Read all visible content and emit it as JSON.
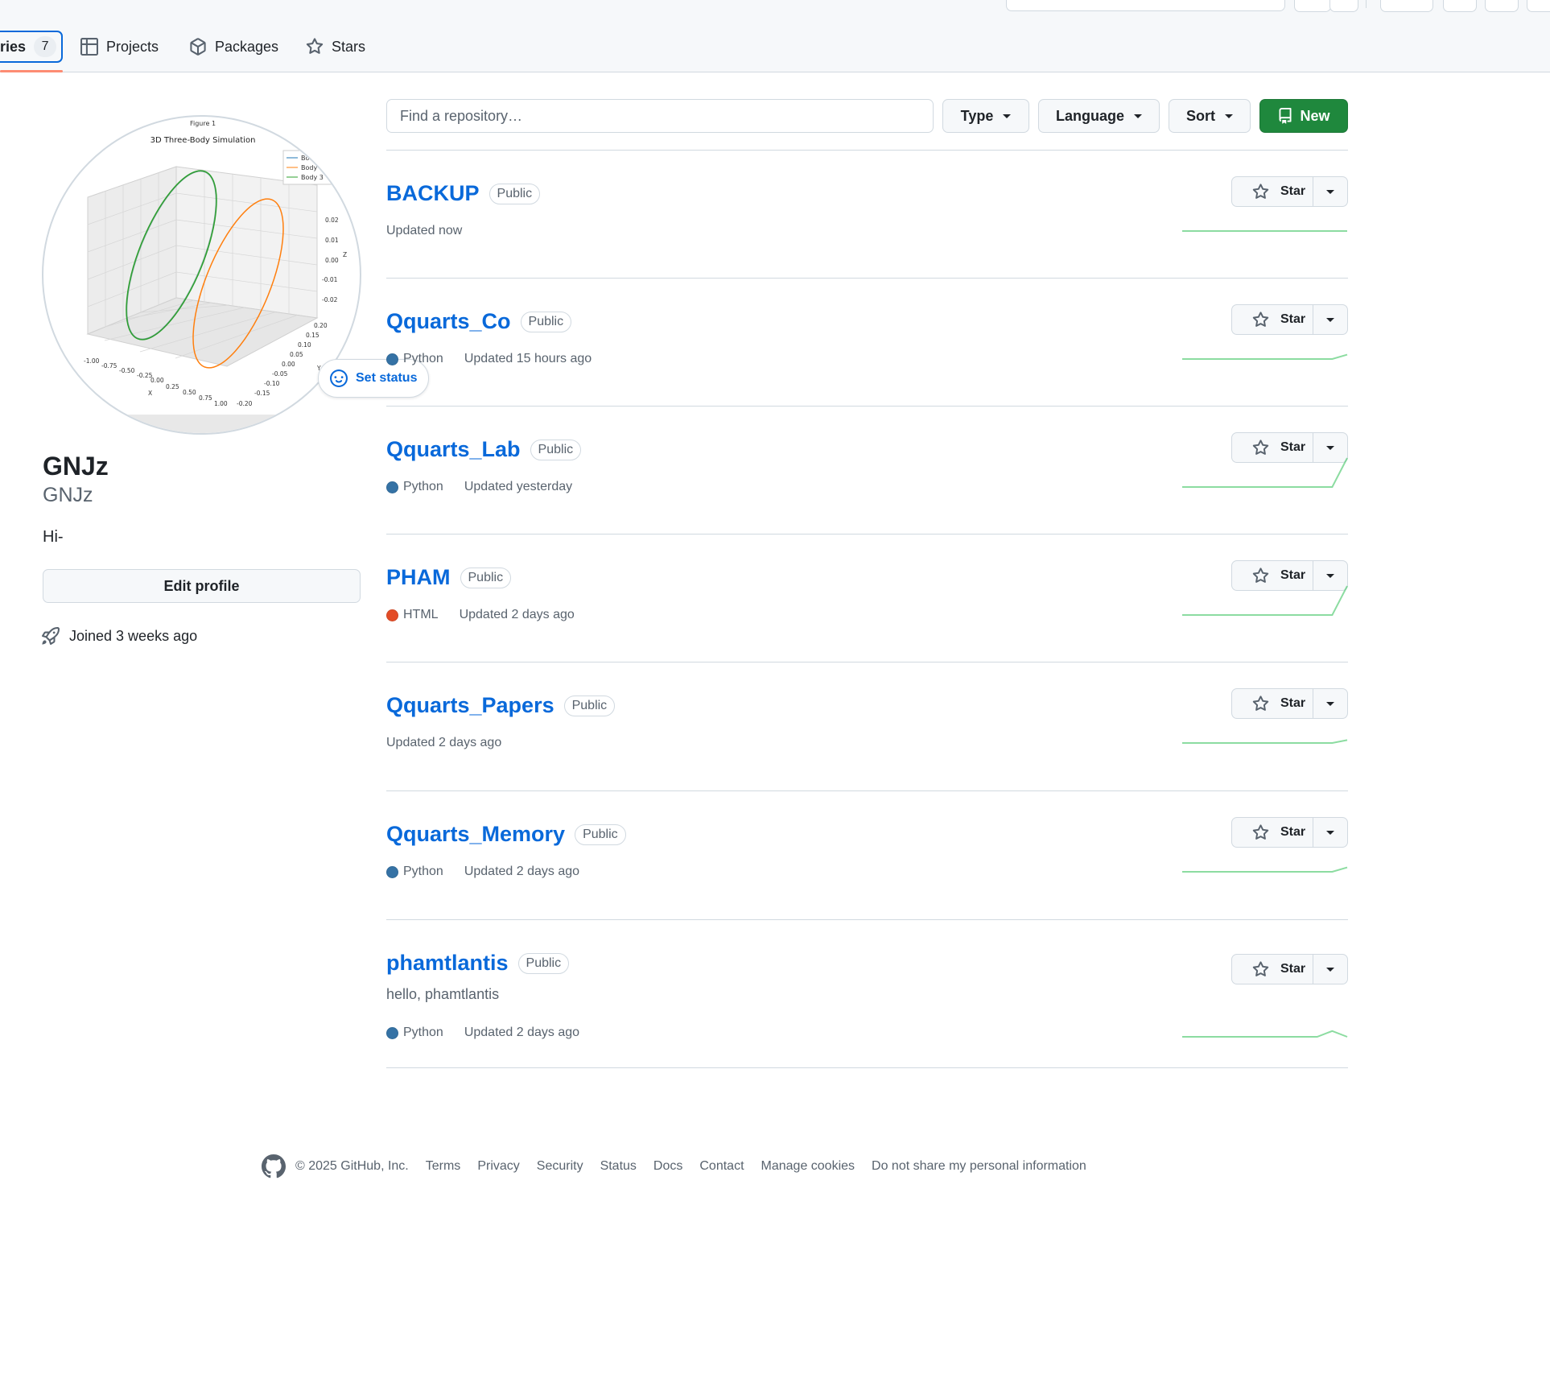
{
  "tabs": [
    {
      "label": "ries",
      "count": "7",
      "active": true,
      "icon": "repo-icon"
    },
    {
      "label": "Projects",
      "icon": "table-icon"
    },
    {
      "label": "Packages",
      "icon": "package-icon"
    },
    {
      "label": "Stars",
      "icon": "star-icon"
    }
  ],
  "profile": {
    "name": "GNJz",
    "login": "GNJz",
    "bio": "Hi-",
    "edit_label": "Edit profile",
    "joined": "Joined 3 weeks ago",
    "set_status_label": "Set status",
    "avatar": {
      "figure_label": "Figure 1",
      "plot_title": "3D Three-Body Simulation",
      "legend": [
        "Body",
        "Body",
        "Body 3"
      ],
      "x_label": "X",
      "y_label": "Y",
      "z_label": "Z",
      "x_ticks": [
        "-1.00",
        "-0.75",
        "-0.50",
        "-0.25",
        "0.00",
        "0.25",
        "0.50",
        "0.75",
        "1.00"
      ],
      "y_ticks": [
        "0.20",
        "0.15",
        "0.10",
        "0.05",
        "0.00",
        "-0.05",
        "-0.10",
        "-0.15",
        "-0.20"
      ],
      "z_ticks": [
        "0.02",
        "0.01",
        "0.00",
        "-0.01",
        "-0.02"
      ],
      "colors": {
        "body1": "#1f77b4",
        "body2": "#ff7f0e",
        "body3": "#2ca02c"
      }
    }
  },
  "filters": {
    "search_placeholder": "Find a repository…",
    "type_label": "Type",
    "language_label": "Language",
    "sort_label": "Sort",
    "new_label": "New"
  },
  "repos": [
    {
      "name": "BACKUP",
      "visibility": "Public",
      "description": "",
      "language": "",
      "language_color": "",
      "updated": "Updated now",
      "star_label": "Star",
      "activity": [
        0,
        0,
        0,
        0,
        0,
        0,
        0,
        0,
        0,
        0,
        0,
        0
      ]
    },
    {
      "name": "Qquarts_Co",
      "visibility": "Public",
      "description": "",
      "language": "Python",
      "language_color": "#3572A5",
      "updated": "Updated 15 hours ago",
      "star_label": "Star",
      "activity": [
        0,
        0,
        0,
        0,
        0,
        0,
        0,
        0,
        0,
        0,
        0,
        0.15
      ]
    },
    {
      "name": "Qquarts_Lab",
      "visibility": "Public",
      "description": "",
      "language": "Python",
      "language_color": "#3572A5",
      "updated": "Updated yesterday",
      "star_label": "Star",
      "activity": [
        0,
        0,
        0,
        0,
        0,
        0,
        0,
        0,
        0,
        0,
        0,
        1
      ]
    },
    {
      "name": "PHAM",
      "visibility": "Public",
      "description": "",
      "language": "HTML",
      "language_color": "#e34c26",
      "updated": "Updated 2 days ago",
      "star_label": "Star",
      "activity": [
        0,
        0,
        0,
        0,
        0,
        0,
        0,
        0,
        0,
        0,
        0,
        1
      ]
    },
    {
      "name": "Qquarts_Papers",
      "visibility": "Public",
      "description": "",
      "language": "",
      "language_color": "",
      "updated": "Updated 2 days ago",
      "star_label": "Star",
      "activity": [
        0,
        0,
        0,
        0,
        0,
        0,
        0,
        0,
        0,
        0,
        0,
        0.1
      ]
    },
    {
      "name": "Qquarts_Memory",
      "visibility": "Public",
      "description": "",
      "language": "Python",
      "language_color": "#3572A5",
      "updated": "Updated 2 days ago",
      "star_label": "Star",
      "activity": [
        0,
        0,
        0,
        0,
        0,
        0,
        0,
        0,
        0,
        0,
        0,
        0.15
      ]
    },
    {
      "name": "phamtlantis",
      "visibility": "Public",
      "description": "hello, phamtlantis",
      "language": "Python",
      "language_color": "#3572A5",
      "updated": "Updated 2 days ago",
      "star_label": "Star",
      "activity": [
        0,
        0,
        0,
        0,
        0,
        0,
        0,
        0,
        0,
        0,
        0.2,
        0
      ]
    }
  ],
  "footer": {
    "copyright": "© 2025 GitHub, Inc.",
    "links": [
      "Terms",
      "Privacy",
      "Security",
      "Status",
      "Docs",
      "Contact",
      "Manage cookies",
      "Do not share my personal information"
    ]
  }
}
